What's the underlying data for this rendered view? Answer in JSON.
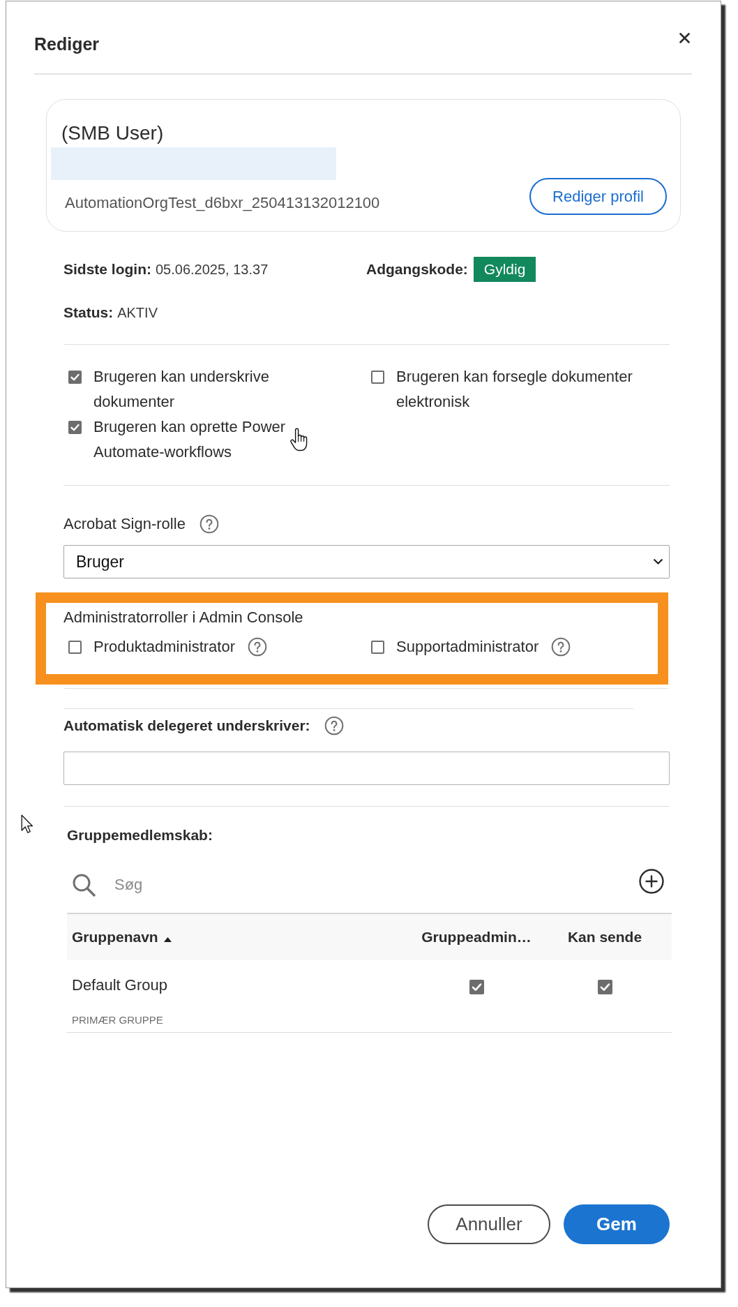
{
  "dialog": {
    "title": "Rediger"
  },
  "profile": {
    "name": "(SMB User)",
    "organization": "AutomationOrgTest_d6bxr_250413132012100",
    "edit_button": "Rediger profil"
  },
  "account": {
    "last_login": {
      "label": "Sidste login:",
      "value": "05.06.2025, 13.37"
    },
    "password": {
      "label": "Adgangskode:",
      "badge": "Gyldig"
    },
    "status": {
      "label": "Status:",
      "value": "AKTIV"
    }
  },
  "permissions": [
    {
      "label": "Brugeren kan underskrive dokumenter",
      "checked": true
    },
    {
      "label": "Brugeren kan oprette Power Automate-workflows",
      "checked": true
    },
    {
      "label": "Brugeren kan forsegle dokumenter elektronisk",
      "checked": false
    }
  ],
  "sign_role": {
    "label": "Acrobat Sign-rolle",
    "value": "Bruger"
  },
  "admin_roles": {
    "title": "Administratorroller i Admin Console",
    "highlighted": true,
    "options": [
      {
        "label": "Produktadministrator",
        "checked": false
      },
      {
        "label": "Supportadministrator",
        "checked": false
      }
    ]
  },
  "delegate_signer": {
    "label": "Automatisk delegeret underskriver:"
  },
  "groups": {
    "title": "Gruppemedlemskab:",
    "search": {
      "placeholder": "Søg"
    },
    "columns": [
      {
        "label": "Gruppenavn",
        "sorted": true
      },
      {
        "label": "Gruppeadmin…",
        "sorted": false
      },
      {
        "label": "Kan sende",
        "sorted": false
      }
    ],
    "rows": [
      {
        "name": "Default Group",
        "tag": "PRIMÆR GRUPPE",
        "group_admin": true,
        "can_send": true
      }
    ]
  },
  "buttons": [
    {
      "label": "Annuller",
      "kind": "secondary"
    },
    {
      "label": "Gem",
      "kind": "primary"
    }
  ]
}
